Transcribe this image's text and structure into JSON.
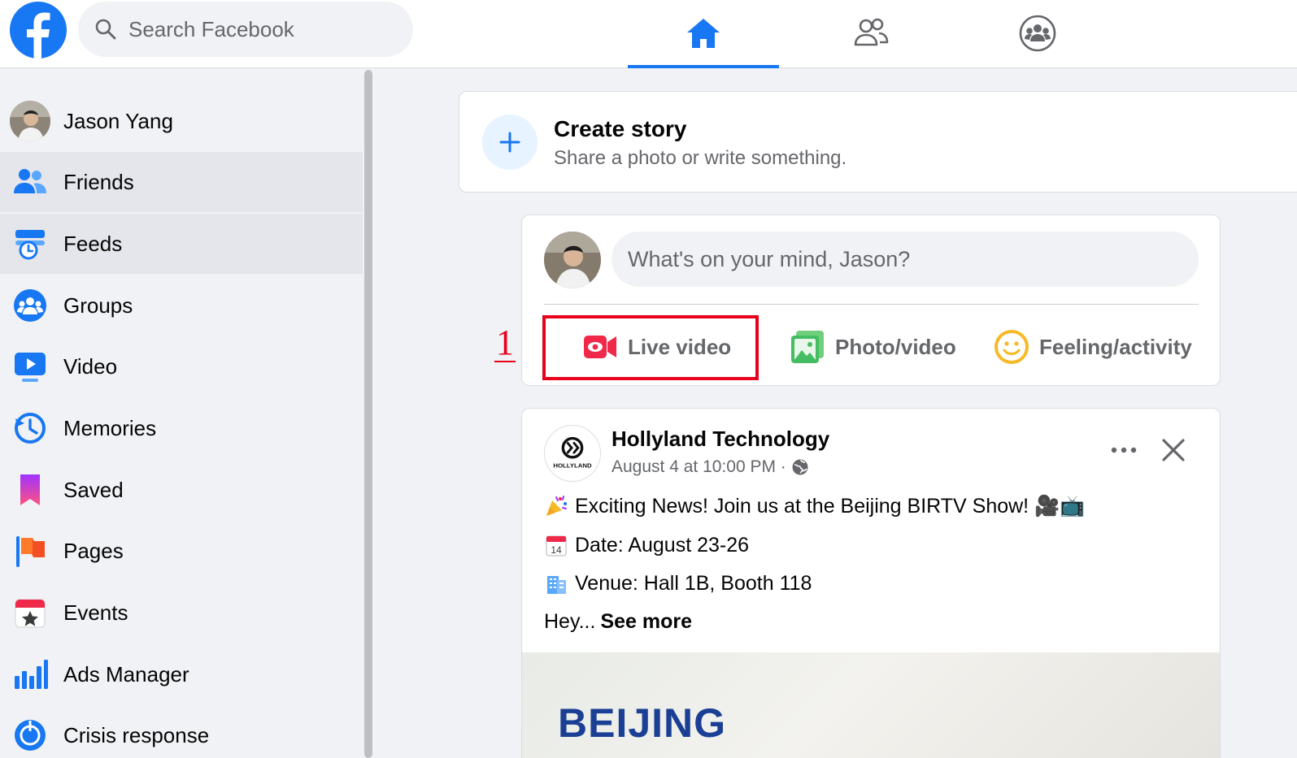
{
  "topbar": {
    "search_placeholder": "Search Facebook",
    "tabs": [
      {
        "name": "home",
        "active": true
      },
      {
        "name": "friends",
        "active": false
      },
      {
        "name": "groups",
        "active": false
      }
    ]
  },
  "sidebar": {
    "items": [
      {
        "label": "Jason Yang",
        "icon": "avatar"
      },
      {
        "label": "Friends",
        "icon": "friends-icon"
      },
      {
        "label": "Feeds",
        "icon": "feeds-icon"
      },
      {
        "label": "Groups",
        "icon": "groups-icon"
      },
      {
        "label": "Video",
        "icon": "video-icon"
      },
      {
        "label": "Memories",
        "icon": "memories-icon"
      },
      {
        "label": "Saved",
        "icon": "saved-icon"
      },
      {
        "label": "Pages",
        "icon": "pages-icon"
      },
      {
        "label": "Events",
        "icon": "events-icon"
      },
      {
        "label": "Ads Manager",
        "icon": "ads-manager-icon"
      },
      {
        "label": "Crisis response",
        "icon": "crisis-response-icon"
      }
    ]
  },
  "story": {
    "title": "Create story",
    "subtitle": "Share a photo or write something."
  },
  "composer": {
    "placeholder": "What's on your mind, Jason?",
    "actions": [
      {
        "label": "Live video",
        "icon": "live-video-icon"
      },
      {
        "label": "Photo/video",
        "icon": "photo-video-icon"
      },
      {
        "label": "Feeling/activity",
        "icon": "feeling-activity-icon"
      }
    ]
  },
  "annotation": {
    "number": "1"
  },
  "post": {
    "author": "Hollyland Technology",
    "logo_text": "HOLLYLAND",
    "meta": "August 4 at 10:00 PM ·",
    "lines": [
      "Exciting News! Join us at the Beijing BIRTV Show! 🎥📺",
      "Date: August 23-26",
      "Venue: Hall 1B, Booth 118"
    ],
    "teaser": "Hey...",
    "see_more": "See more",
    "image_text": "BEIJING"
  },
  "colors": {
    "brand": "#1877f2",
    "annotation": "#e8001c",
    "live": "#f02849",
    "photo": "#45bd62",
    "feeling": "#f7b928"
  }
}
